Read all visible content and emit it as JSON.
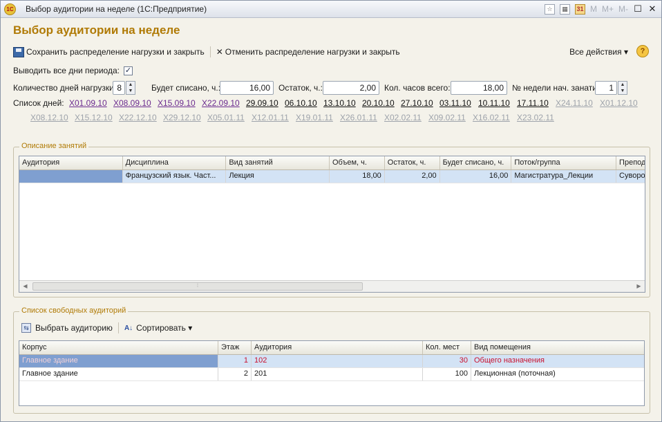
{
  "window": {
    "title": "Выбор аудитории на неделе  (1С:Предприятие)",
    "app_icon_text": "1С",
    "tb_text_m": "M",
    "tb_text_mplus": "M+",
    "tb_text_mminus": "M-",
    "minimize": "☐",
    "close": "✕"
  },
  "form_title": "Выбор аудитории на неделе",
  "toolbar": {
    "save_label": "Сохранить распределение нагрузки и закрыть",
    "cancel_label": "Отменить распределение нагрузки и закрыть",
    "all_actions": "Все действия ▾",
    "help": "?"
  },
  "options": {
    "show_all_days_label": "Выводить все дни периода:",
    "show_all_days_checked": "✓"
  },
  "params": {
    "days_load_label": "Количество дней нагрузки:",
    "days_load_value": "8",
    "written_off_label": "Будет списано, ч.:",
    "written_off_value": "16,00",
    "remainder_label": "Остаток, ч.:",
    "remainder_value": "2,00",
    "total_hours_label": "Кол. часов всего:",
    "total_hours_value": "18,00",
    "week_no_label": "№ недели нач. занатий:",
    "week_no_value": "1"
  },
  "days": {
    "label": "Список дней:",
    "row1": [
      "X01.09.10",
      "X08.09.10",
      "X15.09.10",
      "X22.09.10",
      "29.09.10",
      "06.10.10",
      "13.10.10",
      "20.10.10",
      "27.10.10",
      "03.11.10",
      "10.11.10",
      "17.11.10",
      "X24.11.10",
      "X01.12.10"
    ],
    "row2": [
      "X08.12.10",
      "X15.12.10",
      "X22.12.10",
      "X29.12.10",
      "X05.01.11",
      "X12.01.11",
      "X19.01.11",
      "X26.01.11",
      "X02.02.11",
      "X09.02.11",
      "X16.02.11",
      "X23.02.11"
    ]
  },
  "lessons": {
    "group_title": "Описание занятий",
    "columns": [
      "Аудитория",
      "Дисциплина",
      "Вид занятий",
      "Объем, ч.",
      "Остаток, ч.",
      "Будет списано, ч.",
      "Поток/группа",
      "Препод"
    ],
    "rows": [
      [
        "",
        "Французский язык. Част...",
        "Лекция",
        "18,00",
        "2,00",
        "16,00",
        "Магистратура_Лекции",
        "Суворо"
      ]
    ]
  },
  "rooms": {
    "group_title": "Список свободных аудиторий",
    "pick_label": "Выбрать аудиторию",
    "sort_label": "Сортировать ▾",
    "columns": [
      "Корпус",
      "Этаж",
      "Аудитория",
      "Кол. мест",
      "Вид помещения"
    ],
    "rows": [
      [
        "Главное здание",
        "1",
        "102",
        "30",
        "Общего назначения"
      ],
      [
        "Главное здание",
        "2",
        "201",
        "100",
        "Лекционная (поточная)"
      ]
    ]
  }
}
